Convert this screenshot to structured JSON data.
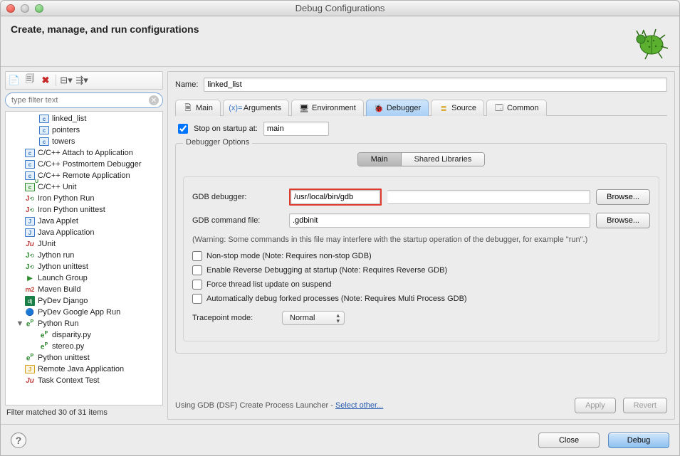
{
  "window": {
    "title": "Debug Configurations"
  },
  "header": {
    "title": "Create, manage, and run configurations"
  },
  "filter": {
    "placeholder": "type filter text",
    "status": "Filter matched 30 of 31 items"
  },
  "tree": {
    "items": [
      {
        "icon": "c",
        "label": "linked_list",
        "indent": 2
      },
      {
        "icon": "c",
        "label": "pointers",
        "indent": 2
      },
      {
        "icon": "c",
        "label": "towers",
        "indent": 2
      },
      {
        "icon": "c",
        "label": "C/C++ Attach to Application",
        "indent": 1
      },
      {
        "icon": "c",
        "label": "C/C++ Postmortem Debugger",
        "indent": 1
      },
      {
        "icon": "c",
        "label": "C/C++ Remote Application",
        "indent": 1
      },
      {
        "icon": "cu",
        "label": "C/C++ Unit",
        "indent": 1
      },
      {
        "icon": "jred",
        "label": "Iron Python Run",
        "indent": 1
      },
      {
        "icon": "jred",
        "label": "Iron Python unittest",
        "indent": 1
      },
      {
        "icon": "j",
        "label": "Java Applet",
        "indent": 1
      },
      {
        "icon": "j",
        "label": "Java Application",
        "indent": 1
      },
      {
        "icon": "ju",
        "label": "JUnit",
        "indent": 1
      },
      {
        "icon": "jgreen",
        "label": "Jython run",
        "indent": 1
      },
      {
        "icon": "jgreen",
        "label": "Jython unittest",
        "indent": 1
      },
      {
        "icon": "launch",
        "label": "Launch Group",
        "indent": 1
      },
      {
        "icon": "m2",
        "label": "Maven Build",
        "indent": 1
      },
      {
        "icon": "dj",
        "label": "PyDev Django",
        "indent": 1
      },
      {
        "icon": "goog",
        "label": "PyDev Google App Run",
        "indent": 1
      },
      {
        "icon": "py",
        "label": "Python Run",
        "indent": 1,
        "expanded": true
      },
      {
        "icon": "py",
        "label": "disparity.py",
        "indent": 2
      },
      {
        "icon": "py",
        "label": "stereo.py",
        "indent": 2
      },
      {
        "icon": "py",
        "label": "Python unittest",
        "indent": 1
      },
      {
        "icon": "jrem",
        "label": "Remote Java Application",
        "indent": 1
      },
      {
        "icon": "ju",
        "label": "Task Context Test",
        "indent": 1
      }
    ]
  },
  "config": {
    "name_label": "Name:",
    "name_value": "linked_list",
    "tabs": {
      "main": "Main",
      "arguments": "Arguments",
      "environment": "Environment",
      "debugger": "Debugger",
      "source": "Source",
      "common": "Common"
    },
    "startup": {
      "label": "Stop on startup at:",
      "value": "main",
      "checked": true
    },
    "group_title": "Debugger Options",
    "subtabs": {
      "main": "Main",
      "shared": "Shared Libraries"
    },
    "gdb_debugger": {
      "label": "GDB debugger:",
      "value": "/usr/local/bin/gdb",
      "browse": "Browse..."
    },
    "gdb_cmd": {
      "label": "GDB command file:",
      "value": ".gdbinit",
      "browse": "Browse..."
    },
    "warning": "(Warning: Some commands in this file may interfere with the startup operation of the debugger, for example \"run\".)",
    "checks": {
      "nonstop": "Non-stop mode (Note: Requires non-stop GDB)",
      "reverse": "Enable Reverse Debugging at startup (Note: Requires Reverse GDB)",
      "force": "Force thread list update on suspend",
      "auto": "Automatically debug forked processes (Note: Requires Multi Process GDB)"
    },
    "tracepoint": {
      "label": "Tracepoint mode:",
      "value": "Normal"
    },
    "launcher": {
      "text": "Using GDB (DSF) Create Process Launcher - ",
      "link": "Select other..."
    },
    "apply": "Apply",
    "revert": "Revert"
  },
  "footer": {
    "close": "Close",
    "debug": "Debug"
  }
}
